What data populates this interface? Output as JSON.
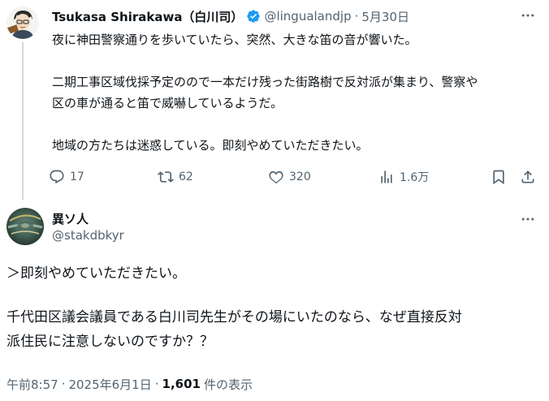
{
  "parent_tweet": {
    "author_name": "Tsukasa Shirakawa（白川司）",
    "handle": "@lingualandjp",
    "separator": "·",
    "date": "5月30日",
    "body_lines": [
      "夜に神田警察通りを歩いていたら、突然、大きな笛の音が響いた。",
      "二期工事区域伐採予定のので一本だけ残った街路樹で反対派が集まり、警察や",
      "区の車が通ると笛で威嚇しているようだ。",
      "地域の方たちは迷惑している。即刻やめていただきたい。"
    ],
    "actions": {
      "replies": "17",
      "reposts": "62",
      "likes": "320",
      "views": "1.6万"
    }
  },
  "reply_tweet": {
    "author_name": "異ソ人",
    "handle": "@stakdbkyr",
    "body_lines": [
      "＞即刻やめていただきたい。",
      "千代田区議会議員である白川司先生がその場にいたのなら、なぜ直接反対",
      "派住民に注意しないのですか？？"
    ],
    "meta": {
      "time": "午前8:57",
      "separator": "·",
      "date": "2025年6月1日",
      "views_count": "1,601",
      "views_label": "件の表示"
    }
  },
  "colors": {
    "text_primary": "#0f1419",
    "text_secondary": "#536471",
    "verified_blue": "#1d9bf0",
    "thread_line": "#cfd9de"
  },
  "icons": [
    "verified-badge-icon",
    "more-icon",
    "reply-icon",
    "repost-icon",
    "like-icon",
    "views-icon",
    "bookmark-icon",
    "share-icon"
  ]
}
